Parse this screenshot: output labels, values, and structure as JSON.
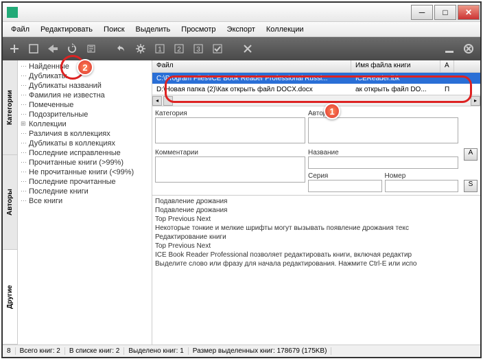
{
  "menu": [
    "Файл",
    "Редактировать",
    "Поиск",
    "Выделить",
    "Просмотр",
    "Экспорт",
    "Коллекции"
  ],
  "sidetabs": [
    "Категории",
    "Авторы",
    "Другие"
  ],
  "tree": [
    "Найденные",
    "Дубликаты",
    "Дубликаты названий",
    "Фамилия не известна",
    "Помеченные",
    "Подозрительные",
    "Коллекции",
    "Различия в коллекциях",
    "Дубликаты в коллекциях",
    "Последние исправленные",
    "Прочитанные книги (>99%)",
    "Не прочитанные книги (<99%)",
    "Последние прочитанные",
    "Последние книги",
    "Все книги"
  ],
  "fl_head": {
    "c1": "Файл",
    "c2": "Имя файла книги",
    "c3": "А"
  },
  "rows": [
    {
      "c1": "C:\\Program Files\\ICE Book Reader Professional Russi...",
      "c2": "ICEReader.ibk",
      "sel": true
    },
    {
      "c1": "D:\\Новая папка (2)\\Как открыть файл DOCX.docx",
      "c2": "ак открыть файл DO...",
      "c3": "П",
      "sel": false
    }
  ],
  "form": {
    "cat": "Категория",
    "author": "Автор",
    "comment": "Комментарии",
    "title": "Название",
    "series": "Серия",
    "num": "Номер",
    "btnA": "A",
    "btnS": "S"
  },
  "help": [
    "Подавление дрожания",
    "Подавление дрожания",
    "Top  Previous  Next",
    "Некоторые тонкие и мелкие шрифты могут вызывать появление дрожания текс",
    "Редактирование книги",
    "Top  Previous  Next",
    "ICE Book Reader Professional позволяет редактировать книги, включая редактир",
    "",
    "Выделите слово или фразу для начала редактирования. Нажмите Ctrl-E или испо"
  ],
  "status": {
    "s0": "8",
    "s1": "Всего книг: 2",
    "s2": "В списке книг: 2",
    "s3": "Выделено книг: 1",
    "s4": "Размер выделенных книг: 178679  (175KB)"
  },
  "badges": {
    "b1": "1",
    "b2": "2"
  }
}
